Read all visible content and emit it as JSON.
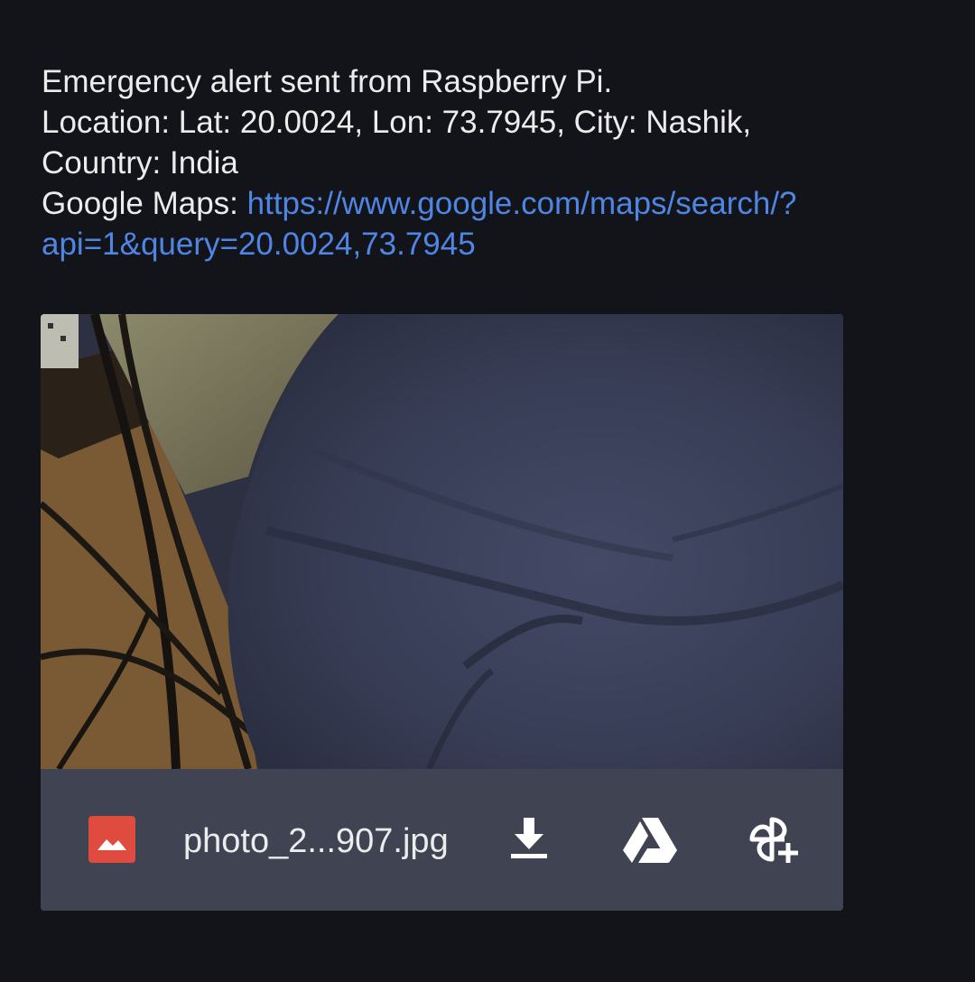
{
  "message": {
    "line1": "Emergency alert sent from Raspberry Pi.",
    "line2": "Location: Lat: 20.0024, Lon: 73.7945, City: Nashik,",
    "line3": "Country: India",
    "maps_label": "Google Maps: ",
    "maps_link_part1": "https://www.google.com/maps/search/?",
    "maps_link_part2": "api=1&query=20.0024,73.7945",
    "maps_url": "https://www.google.com/maps/search/?api=1&query=20.0024,73.7945"
  },
  "attachment": {
    "file_name": "photo_2...907.jpg",
    "file_icon": "image-file-icon",
    "actions": [
      {
        "name": "download-button",
        "icon": "download-icon"
      },
      {
        "name": "save-to-drive-button",
        "icon": "google-drive-icon"
      },
      {
        "name": "add-to-photos-button",
        "icon": "google-photos-add-icon"
      }
    ]
  },
  "colors": {
    "background": "#131419",
    "link": "#4f86e4",
    "attachment_bar": "#3f4352",
    "file_icon": "#e04b3f"
  }
}
